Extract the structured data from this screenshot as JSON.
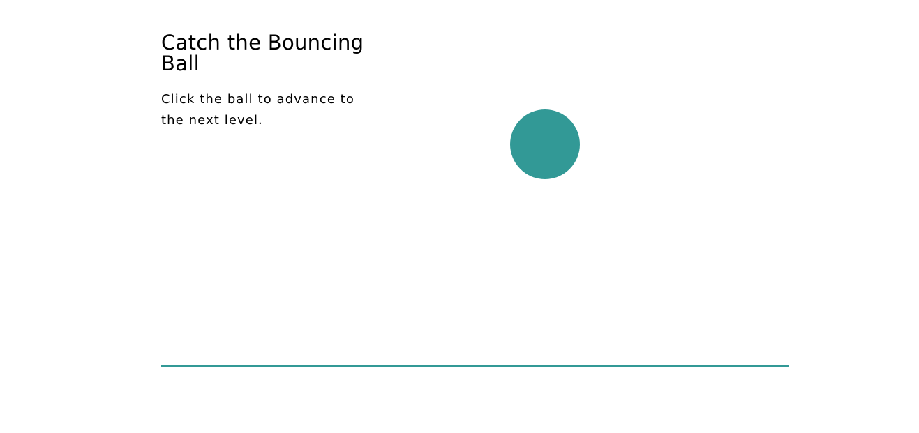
{
  "game": {
    "title": "Catch the Bouncing Ball",
    "instructions": "Click the ball to advance to the next level.",
    "colors": {
      "accent": "#329996",
      "background": "#ffffff",
      "text": "#000000"
    },
    "ball": {
      "icon": "ball-circle"
    },
    "floor": {
      "icon": "floor-line"
    }
  }
}
